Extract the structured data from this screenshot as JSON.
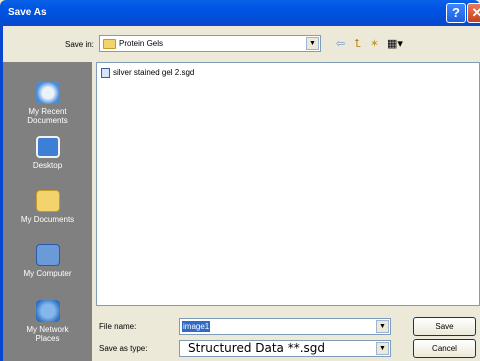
{
  "window": {
    "title": "Save As",
    "help_label": "?",
    "close_label": "✕"
  },
  "toolbar": {
    "save_in_label": "Save in:",
    "save_in_value": "Protein Gels",
    "back_label": "⇦",
    "up_folder_label": "⮤",
    "new_folder_label": "✶",
    "view_menu_label": "▦▾"
  },
  "places": [
    {
      "label_line1": "My Recent",
      "label_line2": "Documents",
      "icon": "recent-documents-icon"
    },
    {
      "label_line1": "Desktop",
      "label_line2": "",
      "icon": "desktop-icon"
    },
    {
      "label_line1": "My Documents",
      "label_line2": "",
      "icon": "my-documents-icon"
    },
    {
      "label_line1": "My Computer",
      "label_line2": "",
      "icon": "my-computer-icon"
    },
    {
      "label_line1": "My Network",
      "label_line2": "Places",
      "icon": "network-places-icon"
    }
  ],
  "files": [
    {
      "name": "silver stained gel 2.sgd"
    }
  ],
  "form": {
    "file_name_label": "File name:",
    "file_name_value": "image1",
    "save_type_label": "Save as type:",
    "save_type_value": "Structured Data **.sgd"
  },
  "buttons": {
    "save": "Save",
    "cancel": "Cancel"
  },
  "colors": {
    "title_bar": "#0055e5",
    "places_bar": "#808080",
    "selection": "#316ac5",
    "dialog_bg": "#ece9d8"
  }
}
